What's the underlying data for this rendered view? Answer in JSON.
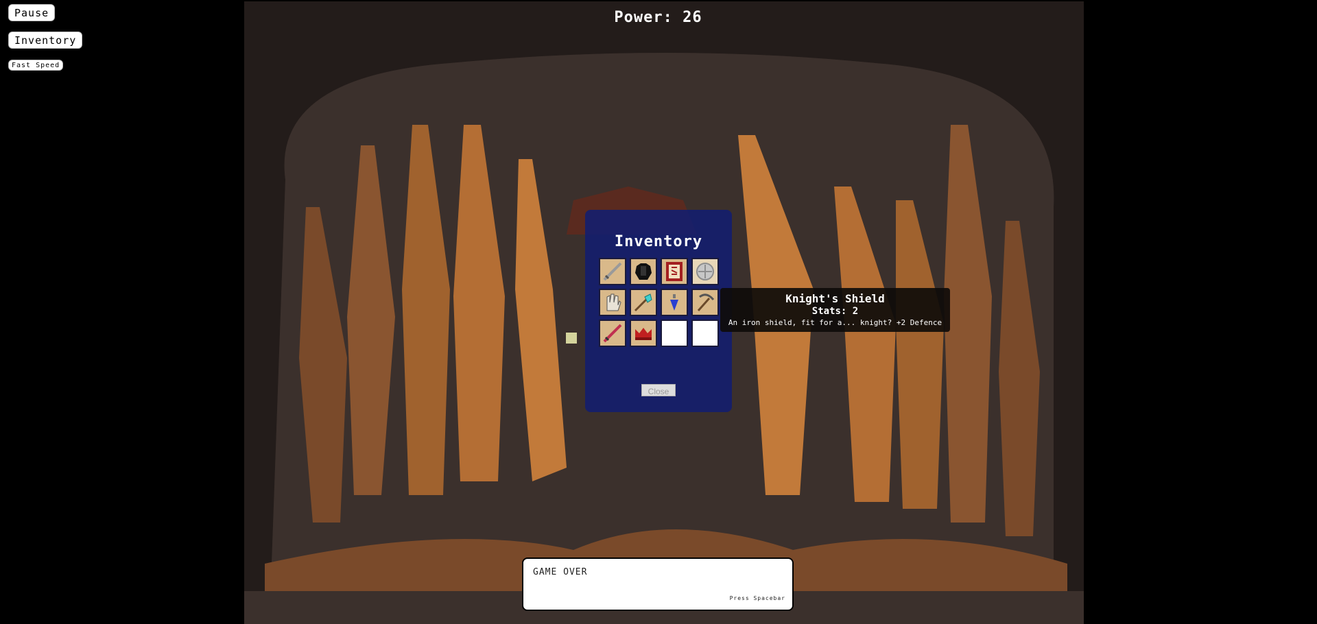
{
  "sidebar": {
    "pause_label": "Pause",
    "inventory_label": "Inventory",
    "fast_speed_label": "Fast Speed"
  },
  "hud": {
    "power_label": "Power: 26"
  },
  "inventory": {
    "title": "Inventory",
    "close_label": "Close",
    "slots": [
      {
        "item": "sword-icon"
      },
      {
        "item": "black-armor-icon"
      },
      {
        "item": "rune-scroll-icon"
      },
      {
        "item": "knights-shield-icon"
      },
      {
        "item": "gauntlet-icon"
      },
      {
        "item": "diamond-shovel-icon"
      },
      {
        "item": "blue-potion-icon"
      },
      {
        "item": "pickaxe-icon"
      },
      {
        "item": "ruby-sword-icon"
      },
      {
        "item": "red-crown-icon"
      },
      {
        "item": "empty"
      },
      {
        "item": "empty"
      }
    ]
  },
  "tooltip": {
    "name": "Knight's Shield",
    "stats": "Stats: 2",
    "description": "An iron shield, fit for a... knight? +2 Defence"
  },
  "dialog": {
    "text": "GAME OVER",
    "hint": "Press Spacebar"
  },
  "colors": {
    "background": "#000000",
    "cave_dark": "#2f2522",
    "panel": "#141e6e",
    "sky": "#a8e6f0"
  }
}
